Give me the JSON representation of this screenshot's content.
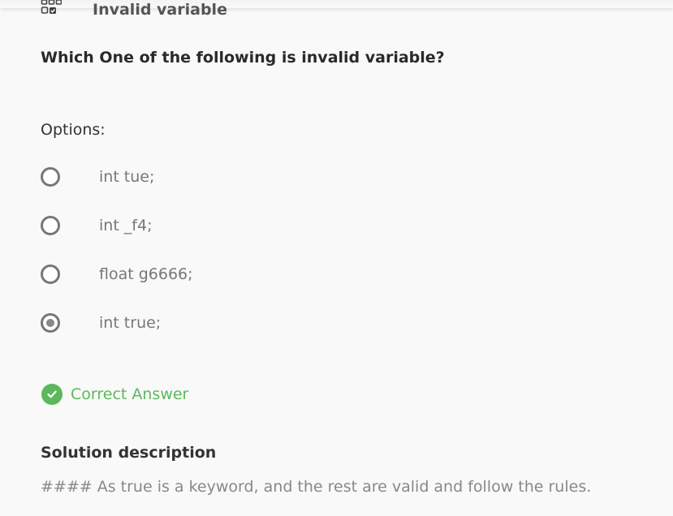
{
  "header": {
    "icon": "quiz-grid-icon",
    "title": "Invalid variable"
  },
  "question": "Which One of the following is invalid variable?",
  "options_label": "Options:",
  "options": [
    {
      "label": "int tue;",
      "selected": false
    },
    {
      "label": "int _f4;",
      "selected": false
    },
    {
      "label": "float g6666;",
      "selected": false
    },
    {
      "label": "int true;",
      "selected": true
    }
  ],
  "result": {
    "icon": "check-circle-icon",
    "text": "Correct Answer",
    "color": "#5cb85c"
  },
  "solution": {
    "title": "Solution description",
    "text": "#### As true is a keyword, and the rest are valid and follow the rules."
  }
}
